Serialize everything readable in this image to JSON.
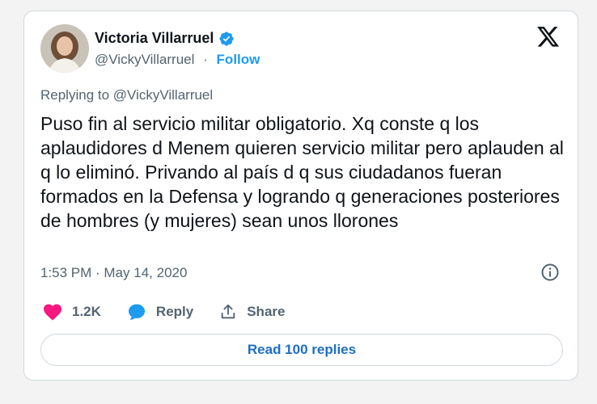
{
  "author": {
    "name": "Victoria Villarruel",
    "handle": "@VickyVillarruel",
    "separator": "·",
    "follow_label": "Follow",
    "verified": true
  },
  "tweet": {
    "replying_to": "Replying to @VickyVillarruel",
    "text": "Puso fin al servicio militar obligatorio. Xq conste q los aplaudidores d Menem quieren servicio militar pero aplauden al q lo eliminó. Privando al país d q sus ciudadanos fueran formados en la Defensa y logrando q generaciones posteriores de hombres (y mujeres) sean unos llorones",
    "timestamp": "1:53 PM · May 14, 2020"
  },
  "actions": {
    "like_count": "1.2K",
    "reply_label": "Reply",
    "share_label": "Share"
  },
  "read_replies_label": "Read 100 replies",
  "colors": {
    "accent": "#1d9bf0",
    "like": "#f91880",
    "text_secondary": "#536471"
  },
  "icons": [
    "x-logo-icon",
    "verified-badge-icon",
    "info-icon",
    "heart-icon",
    "reply-bubble-icon",
    "share-icon"
  ]
}
